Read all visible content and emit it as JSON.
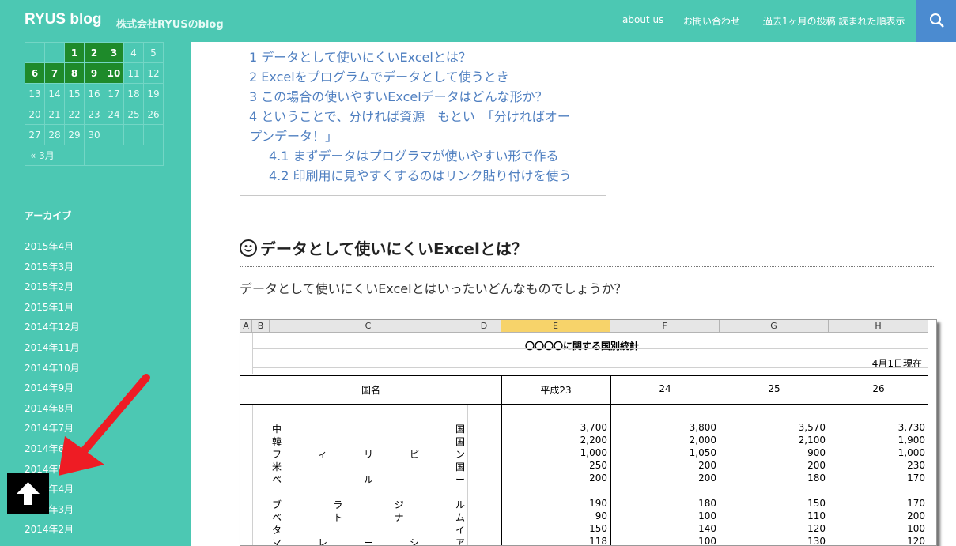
{
  "header": {
    "site_title": "RYUS blog",
    "site_desc": "株式会社RYUSのblog",
    "nav": [
      "about us",
      "お問い合わせ",
      "過去1ヶ月の投稿 読まれた順表示"
    ],
    "search_icon": "search-icon"
  },
  "calendar": {
    "rows": [
      [
        "",
        "",
        "1",
        "2",
        "3",
        "4",
        "5"
      ],
      [
        "6",
        "7",
        "8",
        "9",
        "10",
        "11",
        "12"
      ],
      [
        "13",
        "14",
        "15",
        "16",
        "17",
        "18",
        "19"
      ],
      [
        "20",
        "21",
        "22",
        "23",
        "24",
        "25",
        "26"
      ],
      [
        "27",
        "28",
        "29",
        "30",
        "",
        "",
        ""
      ]
    ],
    "highlighted": [
      "1",
      "2",
      "3",
      "6",
      "7",
      "8",
      "9",
      "10"
    ],
    "prev_link": "« 3月"
  },
  "sidebar": {
    "archive_heading": "アーカイブ",
    "archives": [
      "2015年4月",
      "2015年3月",
      "2015年2月",
      "2015年1月",
      "2014年12月",
      "2014年11月",
      "2014年10月",
      "2014年9月",
      "2014年8月",
      "2014年7月",
      "2014年6月",
      "2014年5月",
      "2014年4月",
      "2014年3月",
      "2014年2月"
    ]
  },
  "toc": {
    "items": [
      "1 データとして使いにくいExcelとは？",
      "2 Excelをプログラムでデータとして使うとき",
      "3 この場合の使いやすいExcelデータはどんな形か？",
      "4 ということで、分ければ資源　もとい　「分ければオー",
      "プンデータ！」",
      "4.1 まずデータはプログラマが使いやすい形で作る",
      "4.2 印刷用に見やすくするのはリンク貼り付けを使う"
    ]
  },
  "section": {
    "title": "データとして使いにくいExcelとは？",
    "icon": "smiley-icon",
    "body": "データとして使いにくいExcelとはいったいどんなものでしょうか？"
  },
  "excel": {
    "col_headers": [
      "A",
      "B",
      "C",
      "D",
      "E",
      "F",
      "G",
      "H"
    ],
    "title": "〇〇〇〇に関する国別統計",
    "date": "4月1日現在",
    "header_labels": [
      "国名",
      "平成23",
      "24",
      "25",
      "26"
    ],
    "rows": [
      {
        "chars": [
          "中",
          "国"
        ],
        "values": [
          "3,700",
          "3,800",
          "3,570",
          "3,730"
        ]
      },
      {
        "chars": [
          "韓",
          "国"
        ],
        "values": [
          "2,200",
          "2,000",
          "2,100",
          "1,900"
        ]
      },
      {
        "chars": [
          "フ",
          "ィ",
          "リ",
          "ピ",
          "ン"
        ],
        "values": [
          "1,000",
          "1,050",
          "900",
          "1,000"
        ]
      },
      {
        "chars": [
          "米",
          "国"
        ],
        "values": [
          "250",
          "200",
          "200",
          "230"
        ]
      },
      {
        "chars": [
          "ペ",
          "ル",
          "ー"
        ],
        "values": [
          "200",
          "200",
          "180",
          "170"
        ]
      },
      {
        "chars": [
          "ブ",
          "ラ",
          "ジ",
          "ル"
        ],
        "values": [
          "190",
          "180",
          "150",
          "170"
        ]
      },
      {
        "chars": [
          "ベ",
          "ト",
          "ナ",
          "ム"
        ],
        "values": [
          "90",
          "100",
          "110",
          "200"
        ]
      },
      {
        "chars": [
          "タ",
          "イ"
        ],
        "values": [
          "150",
          "140",
          "120",
          "100"
        ]
      },
      {
        "chars": [
          "マ",
          "レ",
          "ー",
          "シ",
          "ア"
        ],
        "values": [
          "118",
          "100",
          "130",
          "120"
        ]
      }
    ]
  },
  "scroll_top_icon": "arrow-up-icon",
  "annotation_icon": "red-arrow-icon",
  "colors": {
    "accent": "#4cc8b3",
    "calendar_highlight": "#1e8a2a",
    "link": "#4f7fc0",
    "search_bg": "#4b8bd0"
  }
}
